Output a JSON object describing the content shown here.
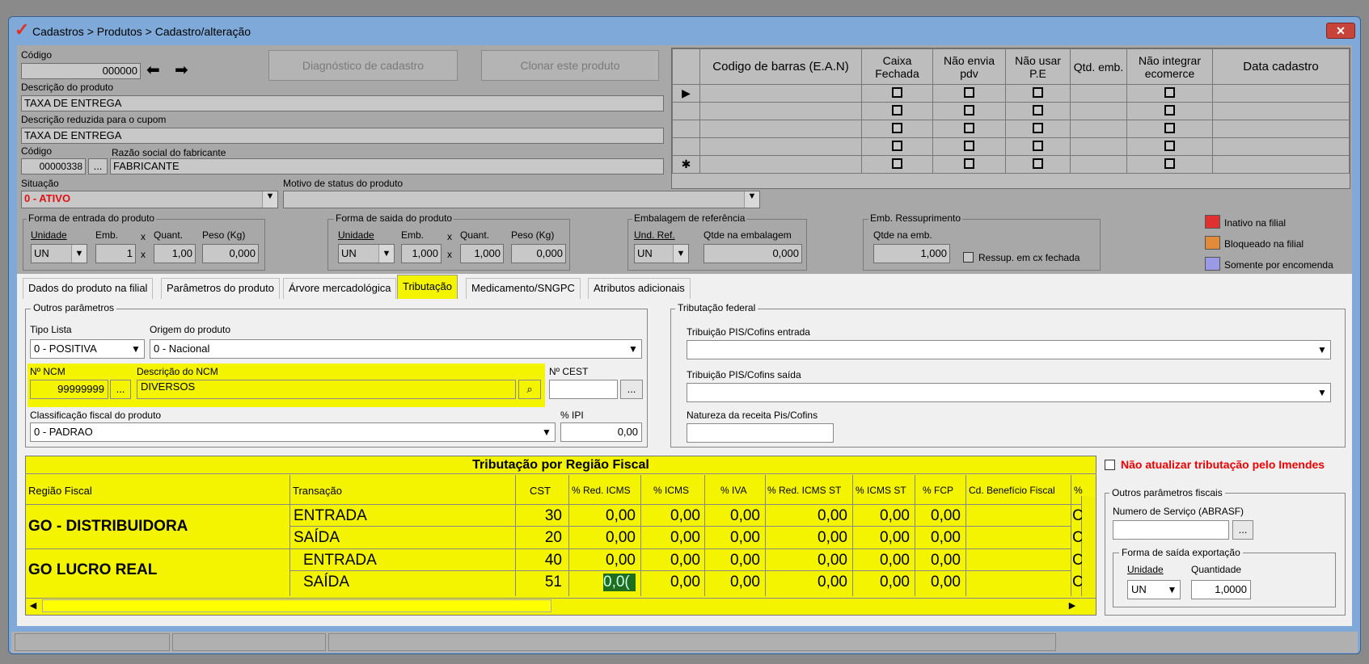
{
  "window": {
    "title": "Cadastros > Produtos > Cadastro/alteração",
    "close_label": "✕"
  },
  "top": {
    "codigo_label": "Código",
    "codigo_value": "000000",
    "btn_diag": "Diagnóstico de cadastro",
    "btn_clone": "Clonar este produto",
    "descricao_label": "Descrição  do produto",
    "descricao_value": "TAXA DE ENTREGA",
    "desc_reduzida_label": "Descrição reduzida para o cupom",
    "desc_reduzida_value": "TAXA DE ENTREGA",
    "fab_codigo_label": "Código",
    "fab_codigo_value": "00000338",
    "fab_razao_label": "Razão social do fabricante",
    "fab_razao_value": "FABRICANTE",
    "situacao_label": "Situação",
    "situacao_value": "0 - ATIVO",
    "motivo_label": "Motivo de status do produto",
    "motivo_value": "",
    "ellipsis": "..."
  },
  "barcode_grid": {
    "headers": [
      "Codigo de barras (E.A.N)",
      "Caixa Fechada",
      "Não envia pdv",
      "Não usar P.E",
      "Qtd. emb.",
      "Não integrar ecomerce",
      "Data cadastro"
    ]
  },
  "entrada": {
    "title": "Forma de entrada do produto",
    "unidade_label": "Unidade",
    "unidade_value": "UN",
    "emb_label": "Emb.",
    "emb_value": "1",
    "quant_label": "Quant.",
    "quant_value": "1,00",
    "peso_label": "Peso (Kg)",
    "peso_value": "0,000",
    "x": "x"
  },
  "saida": {
    "title": "Forma de saida do produto",
    "unidade_label": "Unidade",
    "unidade_value": "UN",
    "emb_label": "Emb.",
    "emb_value": "1,000",
    "quant_label": "Quant.",
    "quant_value": "1,000",
    "peso_label": "Peso (Kg)",
    "peso_value": "0,000",
    "x": "x"
  },
  "embalagem": {
    "title": "Embalagem de referência",
    "und_label": "Und. Ref.",
    "und_value": "UN",
    "qtde_label": "Qtde na embalagem",
    "qtde_value": "0,000"
  },
  "ressup": {
    "title": "Emb. Ressuprimento",
    "qtde_label": "Qtde na emb.",
    "qtde_value": "1,000",
    "cx_label": "Ressup. em cx fechada"
  },
  "legend": [
    {
      "label": "Inativo na filial",
      "color": "#e03030"
    },
    {
      "label": "Bloqueado na filial",
      "color": "#e08a3a"
    },
    {
      "label": "Somente por encomenda",
      "color": "#9a9ae6"
    }
  ],
  "tabs": [
    "Dados do produto na filial",
    "Parâmetros do produto",
    "Árvore mercadológica",
    "Tributação",
    "Medicamento/SNGPC",
    "Atributos adicionais"
  ],
  "outros": {
    "title": "Outros parâmetros",
    "tipo_label": "Tipo Lista",
    "tipo_value": "0 - POSITIVA",
    "origem_label": "Origem do produto",
    "origem_value": "0 - Nacional",
    "ncm_label": "Nº NCM",
    "ncm_value": "99999999",
    "ncm_desc_label": "Descrição do NCM",
    "ncm_desc_value": "DIVERSOS",
    "cest_label": "Nº CEST",
    "cest_value": "",
    "class_label": "Classificação fiscal do produto",
    "class_value": "0 - PADRAO",
    "ipi_label": "% IPI",
    "ipi_value": "0,00"
  },
  "federal": {
    "title": "Tributação federal",
    "entrada_label": "Tribuição PIS/Cofins entrada",
    "saida_label": "Tribuição PIS/Cofins saída",
    "natureza_label": "Natureza da receita Pis/Cofins"
  },
  "regiao": {
    "title": "Tributação por Região Fiscal",
    "headers": [
      "Região Fiscal",
      "Transação",
      "CST",
      "% Red. ICMS",
      "% ICMS",
      "% IVA",
      "% Red. ICMS ST",
      "% ICMS ST",
      "% FCP",
      "Cd. Benefício Fiscal",
      "%"
    ],
    "groups": [
      {
        "name": "GO - DISTRIBUIDORA",
        "rows": [
          {
            "transacao": "ENTRADA",
            "cst": "30",
            "red": "0,00",
            "icms": "0,00",
            "iva": "0,00",
            "redst": "0,00",
            "icmsst": "0,00",
            "fcp": "0,00",
            "ben": "",
            "last": "C"
          },
          {
            "transacao": "SAÍDA",
            "cst": "20",
            "red": "0,00",
            "icms": "0,00",
            "iva": "0,00",
            "redst": "0,00",
            "icmsst": "0,00",
            "fcp": "0,00",
            "ben": "",
            "last": "C"
          }
        ]
      },
      {
        "name": "GO LUCRO REAL",
        "rows": [
          {
            "transacao": "ENTRADA",
            "cst": "40",
            "red": "0,00",
            "icms": "0,00",
            "iva": "0,00",
            "redst": "0,00",
            "icmsst": "0,00",
            "fcp": "0,00",
            "ben": "",
            "last": "C"
          },
          {
            "transacao": "SAÍDA",
            "cst": "51",
            "red": "0,0(",
            "icms": "0,00",
            "iva": "0,00",
            "redst": "0,00",
            "icmsst": "0,00",
            "fcp": "0,00",
            "ben": "",
            "last": "C"
          }
        ]
      }
    ]
  },
  "right": {
    "nao_atualizar": "Não atualizar tributação pelo Imendes",
    "outros_fiscais_title": "Outros parâmetros fiscais",
    "num_servico_label": "Numero de Serviço (ABRASF)",
    "num_servico_value": "",
    "exportacao_title": "Forma de saída exportação",
    "unidade_label": "Unidade",
    "unidade_value": "UN",
    "quantidade_label": "Quantidade",
    "quantidade_value": "1,0000"
  }
}
